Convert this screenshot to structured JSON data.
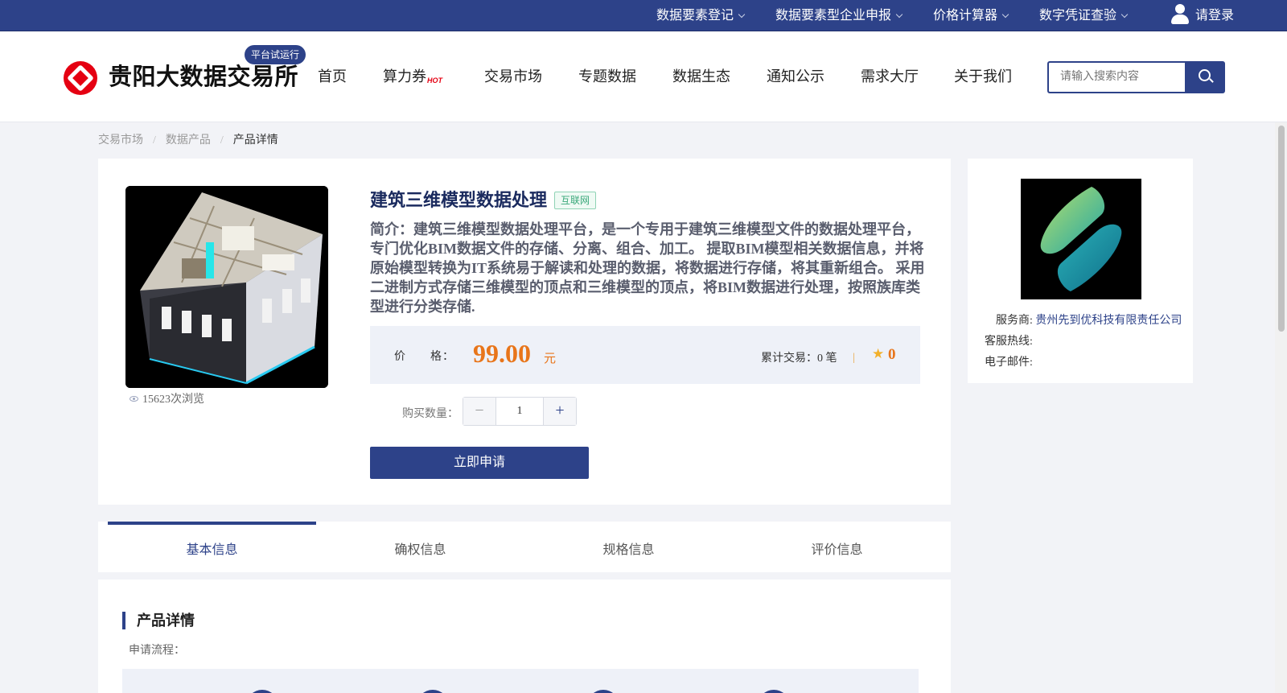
{
  "topbar": {
    "items": [
      {
        "label": "数据要素登记"
      },
      {
        "label": "数据要素型企业申报"
      },
      {
        "label": "价格计算器"
      },
      {
        "label": "数字凭证查验"
      }
    ],
    "login_label": "请登录"
  },
  "header": {
    "site_title": "贵阳大数据交易所",
    "trial_badge": "平台试运行",
    "nav": [
      {
        "label": "首页"
      },
      {
        "label": "算力券",
        "badge": "HOT"
      },
      {
        "label": "交易市场"
      },
      {
        "label": "专题数据"
      },
      {
        "label": "数据生态"
      },
      {
        "label": "通知公示"
      },
      {
        "label": "需求大厅"
      },
      {
        "label": "关于我们"
      }
    ],
    "search_placeholder": "请输入搜索内容"
  },
  "breadcrumb": {
    "items": [
      "交易市场",
      "数据产品"
    ],
    "current": "产品详情",
    "separator": "/"
  },
  "product": {
    "title": "建筑三维模型数据处理",
    "tag": "互联网",
    "description": "简介：建筑三维模型数据处理平台，是一个专用于建筑三维模型文件的数据处理平台，专门优化BIM数据文件的存储、分离、组合、加工。 提取BIM模型相关数据信息，并将原始模型转换为IT系统易于解读和处理的数据，将数据进行存储，将其重新组合。 采用二进制方式存储三维模型的顶点和三维模型的顶点，将BIM数据进行处理，按照族库类型进行分类存储.",
    "views": "15623次浏览",
    "price_label": "价　　格：",
    "price": "99.00",
    "price_unit": "元",
    "trade_label": "累计交易：",
    "trade_count": "0",
    "trade_unit": "笔",
    "divider": "|",
    "rating": "0",
    "quantity_label": "购买数量：",
    "quantity": "1",
    "minus": "−",
    "plus": "+",
    "apply_label": "立即申请"
  },
  "provider": {
    "provider_label": "服务商:",
    "provider_name": "贵州先到优科技有限责任公司",
    "hotline_label": "客服热线:",
    "email_label": "电子邮件:"
  },
  "tabs": [
    {
      "label": "基本信息",
      "active": true
    },
    {
      "label": "确权信息"
    },
    {
      "label": "规格信息"
    },
    {
      "label": "评价信息"
    }
  ],
  "detail": {
    "section_title": "产品详情",
    "process_label": "申请流程："
  },
  "colors": {
    "brand": "#2d4289",
    "accent_price": "#e8751a",
    "logo_red": "#e50012",
    "tag_green": "#3aa87a"
  },
  "icons": [
    "chevron-down-icon",
    "user-icon",
    "search-icon",
    "hot-icon",
    "eye-icon",
    "star-icon"
  ]
}
